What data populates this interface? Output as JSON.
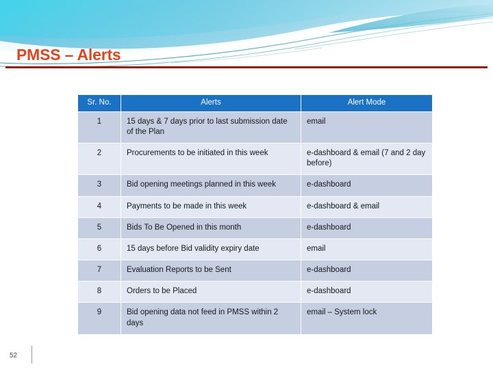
{
  "slide": {
    "title": "PMSS – Alerts",
    "number": "52",
    "accent_color": "#E2451B",
    "rule_color": "#9E1B0E",
    "header_blue": "#1B72C4",
    "row_shade_dark": "#C6CFE2",
    "row_shade_light": "#E3E8F3"
  },
  "table": {
    "columns": [
      "Sr. No.",
      "Alerts",
      "Alert Mode"
    ],
    "rows": [
      {
        "sr": "1",
        "alert": "15 days & 7 days prior to last submission date of the Plan",
        "mode": "email"
      },
      {
        "sr": "2",
        "alert": "Procurements to be initiated in this week",
        "mode": "e-dashboard & email (7 and 2 day before)"
      },
      {
        "sr": "3",
        "alert": "Bid opening meetings planned in this week",
        "mode": "e-dashboard"
      },
      {
        "sr": "4",
        "alert": "Payments  to be made in this week",
        "mode": "e-dashboard & email"
      },
      {
        "sr": "5",
        "alert": "Bids To Be Opened  in this month",
        "mode": "e-dashboard"
      },
      {
        "sr": "6",
        "alert": "15 days before Bid validity expiry date",
        "mode": "email"
      },
      {
        "sr": "7",
        "alert": "Evaluation Reports to be Sent",
        "mode": "e-dashboard"
      },
      {
        "sr": "8",
        "alert": "Orders  to be Placed",
        "mode": "e-dashboard"
      },
      {
        "sr": "9",
        "alert": "Bid opening data not feed in PMSS within 2 days",
        "mode": "email – System lock"
      }
    ]
  }
}
